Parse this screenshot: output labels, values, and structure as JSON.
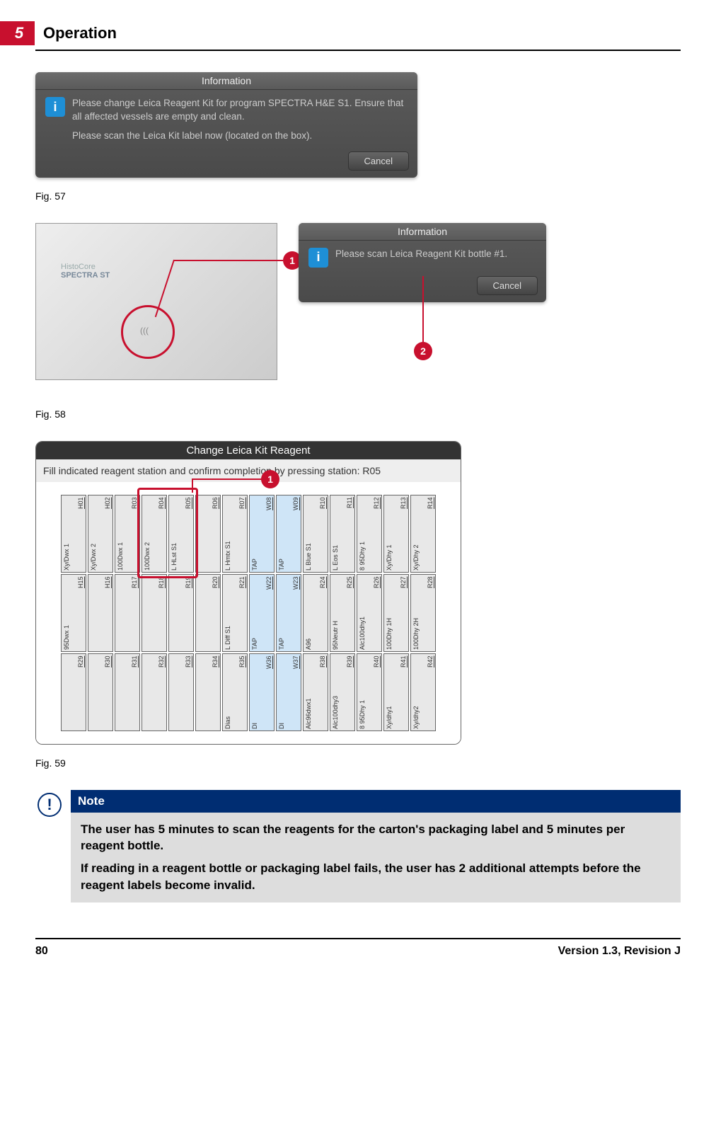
{
  "header": {
    "chapter_number": "5",
    "chapter_title": "Operation"
  },
  "fig57": {
    "dialog_title": "Information",
    "line1": "Please change Leica Reagent Kit for program SPECTRA H&E S1. Ensure that all affected vessels are empty and clean.",
    "line2": "Please scan the Leica Kit label now (located on the box).",
    "cancel": "Cancel",
    "caption": "Fig. 57"
  },
  "fig58": {
    "device_brand1": "HistoCore",
    "device_brand2": "SPECTRA ST",
    "callout1": "1",
    "callout2": "2",
    "dialog_title": "Information",
    "line1": "Please scan Leica Reagent Kit bottle #1.",
    "cancel": "Cancel",
    "caption": "Fig. 58"
  },
  "fig59": {
    "title": "Change Leica Kit Reagent",
    "instruction": "Fill indicated reagent station and confirm completion by pressing station: R05",
    "callout1": "1",
    "caption": "Fig. 59",
    "columns": [
      {
        "id": "H01",
        "name": "Xy/Dwx 1",
        "cls": "reagent",
        "r2id": "H15",
        "r2name": "95Dwx 1",
        "r2cls": "reagent",
        "r3id": "R29",
        "r3name": "",
        "r3cls": "reagent"
      },
      {
        "id": "H02",
        "name": "Xy/Dwx 2",
        "cls": "reagent",
        "r2id": "H16",
        "r2name": "",
        "r2cls": "reagent",
        "r3id": "R30",
        "r3name": "",
        "r3cls": "reagent"
      },
      {
        "id": "R03",
        "name": "100Dwx 1",
        "cls": "reagent",
        "r2id": "R17",
        "r2name": "",
        "r2cls": "reagent",
        "r3id": "R31",
        "r3name": "",
        "r3cls": "reagent"
      },
      {
        "id": "R04",
        "name": "100Dwx 2",
        "cls": "reagent",
        "r2id": "R18",
        "r2name": "",
        "r2cls": "reagent",
        "r3id": "R32",
        "r3name": "",
        "r3cls": "reagent"
      },
      {
        "id": "R05",
        "name": "L HLst S1",
        "cls": "reagent",
        "r2id": "R19",
        "r2name": "",
        "r2cls": "reagent",
        "r3id": "R33",
        "r3name": "",
        "r3cls": "reagent"
      },
      {
        "id": "R06",
        "name": "",
        "cls": "reagent",
        "r2id": "R20",
        "r2name": "",
        "r2cls": "reagent",
        "r3id": "R34",
        "r3name": "",
        "r3cls": "reagent"
      },
      {
        "id": "R07",
        "name": "L Hmtx S1",
        "cls": "reagent",
        "r2id": "R21",
        "r2name": "L Diff S1",
        "r2cls": "reagent",
        "r3id": "R35",
        "r3name": "Dias",
        "r3cls": "reagent"
      },
      {
        "id": "W08",
        "name": "TAP",
        "cls": "water",
        "r2id": "W22",
        "r2name": "TAP",
        "r2cls": "water",
        "r3id": "W36",
        "r3name": "DI",
        "r3cls": "water"
      },
      {
        "id": "W09",
        "name": "TAP",
        "cls": "water",
        "r2id": "W23",
        "r2name": "TAP",
        "r2cls": "water",
        "r3id": "W37",
        "r3name": "DI",
        "r3cls": "water"
      },
      {
        "id": "R10",
        "name": "L Blue S1",
        "cls": "reagent",
        "r2id": "R24",
        "r2name": "A96",
        "r2cls": "reagent",
        "r3id": "R38",
        "r3name": "Alc96dwx1",
        "r3cls": "reagent"
      },
      {
        "id": "R11",
        "name": "L Eos S1",
        "cls": "reagent",
        "r2id": "R25",
        "r2name": "95Neutr H",
        "r2cls": "reagent",
        "r3id": "R39",
        "r3name": "Alc100dhy3",
        "r3cls": "reagent"
      },
      {
        "id": "R12",
        "name": "8 95Dhy 1",
        "cls": "reagent",
        "r2id": "R26",
        "r2name": "Alc100dhy1",
        "r2cls": "reagent",
        "r3id": "R40",
        "r3name": "8 95Dhy 1",
        "r3cls": "reagent"
      },
      {
        "id": "R13",
        "name": "Xy/Dhy 1",
        "cls": "reagent",
        "r2id": "R27",
        "r2name": "100Dhy 1H",
        "r2cls": "reagent",
        "r3id": "R41",
        "r3name": "Xy/dhy1",
        "r3cls": "reagent"
      },
      {
        "id": "R14",
        "name": "Xy/Dhy 2",
        "cls": "reagent",
        "r2id": "R28",
        "r2name": "100Dhy 2H",
        "r2cls": "reagent",
        "r3id": "R42",
        "r3name": "Xy/dhy2",
        "r3cls": "reagent"
      }
    ]
  },
  "note": {
    "title": "Note",
    "p1": "The user has 5 minutes to scan the reagents for the carton's packaging label and 5 minutes per reagent bottle.",
    "p2": "If reading in a reagent bottle or packaging label fails, the user has 2 additional attempts before the reagent labels become invalid."
  },
  "footer": {
    "page": "80",
    "version": "Version 1.3, Revision J"
  }
}
